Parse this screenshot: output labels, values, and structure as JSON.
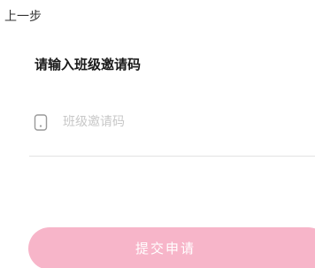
{
  "header": {
    "back_label": "上一步"
  },
  "form": {
    "title": "请输入班级邀请码",
    "code_input": {
      "placeholder": "班级邀请码",
      "value": "",
      "icon": "phone-icon"
    },
    "submit_label": "提交申请"
  },
  "colors": {
    "accent": "#f7b5c9",
    "text_primary": "#1a1a1a",
    "placeholder": "#c8c8c8",
    "divider": "#e3e3e3"
  }
}
